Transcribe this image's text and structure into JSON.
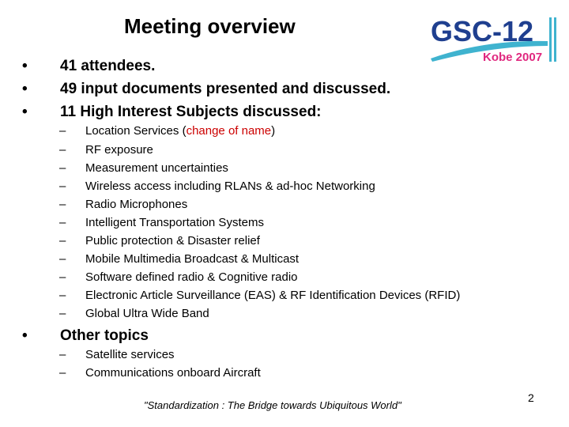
{
  "slide": {
    "title": "Meeting overview",
    "logo": {
      "main_text": "GSC-12",
      "sub_text": "Kobe 2007",
      "colors": {
        "main": "#1f3f8f",
        "sub": "#e0287f",
        "bridge": "#3fb3cf"
      }
    },
    "bullets": [
      {
        "marker": "•",
        "text": "41 attendees."
      },
      {
        "marker": "•",
        "text": "49 input documents presented and discussed."
      },
      {
        "marker": "•",
        "text": "11 High Interest Subjects discussed:"
      }
    ],
    "subjects": [
      {
        "marker": "–",
        "text": "Location Services (",
        "highlight": "change of name",
        "after": ")"
      },
      {
        "marker": "–",
        "text": "RF exposure"
      },
      {
        "marker": "–",
        "text": "Measurement uncertainties"
      },
      {
        "marker": "–",
        "text": "Wireless access including RLANs & ad-hoc Networking"
      },
      {
        "marker": "–",
        "text": "Radio Microphones"
      },
      {
        "marker": "–",
        "text": "Intelligent Transportation Systems"
      },
      {
        "marker": "–",
        "text": "Public protection & Disaster relief"
      },
      {
        "marker": "–",
        "text": "Mobile Multimedia Broadcast & Multicast"
      },
      {
        "marker": "–",
        "text": "Software defined radio & Cognitive radio"
      },
      {
        "marker": "–",
        "text": "Electronic Article Surveillance (EAS) & RF Identification Devices (RFID)"
      },
      {
        "marker": "–",
        "text": "Global Ultra Wide Band"
      }
    ],
    "other": {
      "marker": "•",
      "text": "Other topics",
      "items": [
        {
          "marker": "–",
          "text": "Satellite services"
        },
        {
          "marker": "–",
          "text": "Communications onboard Aircraft"
        }
      ]
    },
    "footer": "\"Standardization : The Bridge towards Ubiquitous World\"",
    "page_number": "2",
    "highlight_color": "#cc0000"
  }
}
